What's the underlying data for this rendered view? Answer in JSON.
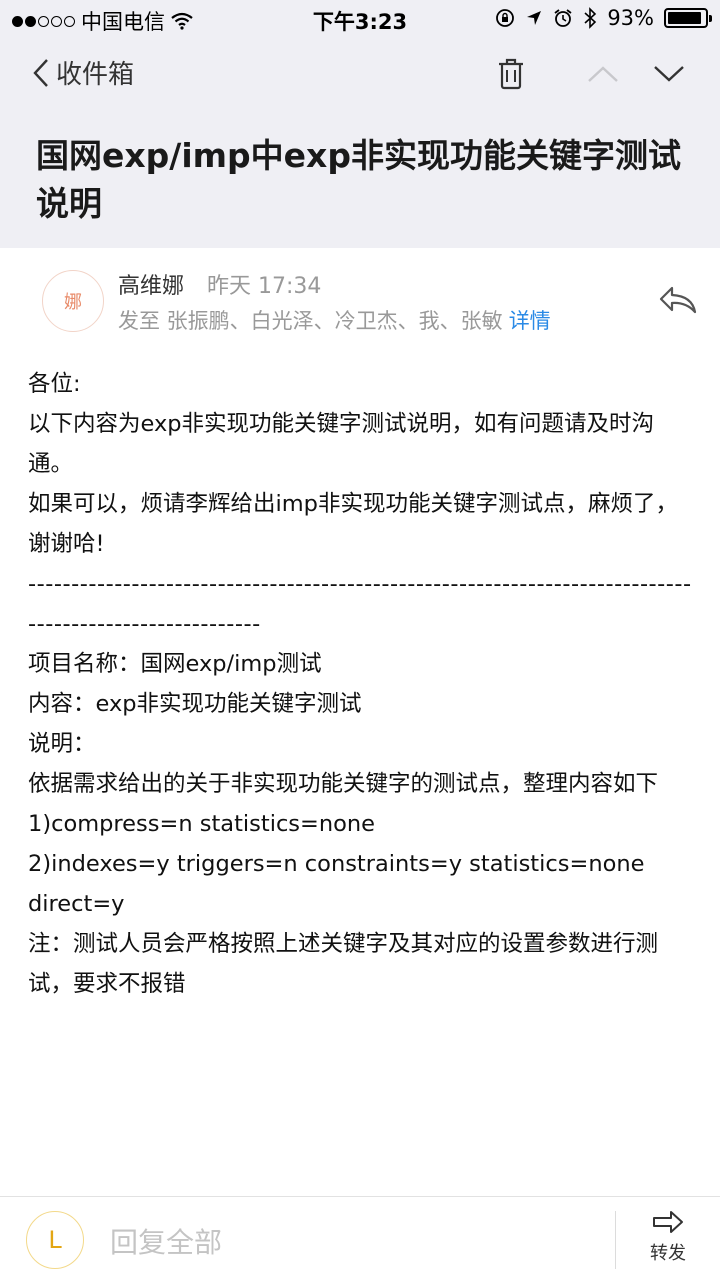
{
  "status_bar": {
    "carrier": "中国电信",
    "time": "下午3:23",
    "battery_percent": "93%",
    "battery_level": 0.93
  },
  "nav": {
    "back_label": "收件箱"
  },
  "mail": {
    "subject": "国网exp/imp中exp非实现功能关键字测试说明",
    "sender_name": "高维娜",
    "sender_avatar_char": "娜",
    "time": "昨天 17:34",
    "recipients": "发至 张振鹏、白光泽、冷卫杰、我、张敏",
    "details_label": "详情",
    "body": [
      "各位:",
      "以下内容为exp非实现功能关键字测试说明，如有问题请及时沟通。",
      "如果可以，烦请李辉给出imp非实现功能关键字测试点，麻烦了，谢谢哈!",
      "--------------------------------------------------------------------------------------------------------",
      "项目名称：国网exp/imp测试",
      "内容：exp非实现功能关键字测试",
      "说明：",
      "依据需求给出的关于非实现功能关键字的测试点，整理内容如下",
      "1)compress=n statistics=none",
      "2)indexes=y triggers=n constraints=y statistics=none direct=y",
      "注：测试人员会严格按照上述关键字及其对应的设置参数进行测试，要求不报错"
    ]
  },
  "bottom": {
    "avatar_char": "L",
    "reply_all_placeholder": "回复全部",
    "forward_label": "转发"
  },
  "colors": {
    "header_bg": "#efeff4",
    "link": "#2a8ae6",
    "avatar_orange": "#e88a68",
    "avatar_yellow": "#e3a614"
  }
}
